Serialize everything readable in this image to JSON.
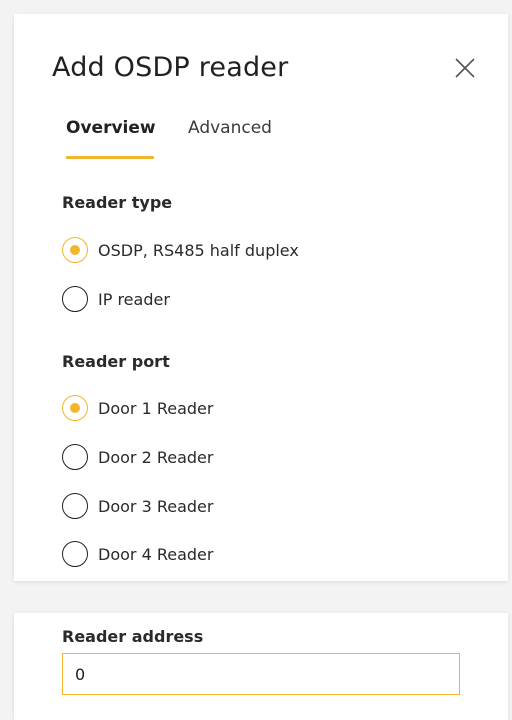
{
  "dialog": {
    "title": "Add OSDP reader",
    "close_icon": "close-icon"
  },
  "tabs": [
    {
      "label": "Overview",
      "active": true
    },
    {
      "label": "Advanced",
      "active": false
    }
  ],
  "reader_type": {
    "label": "Reader type",
    "options": [
      {
        "label": "OSDP, RS485 half duplex",
        "selected": true
      },
      {
        "label": "IP reader",
        "selected": false
      }
    ]
  },
  "reader_port": {
    "label": "Reader port",
    "options": [
      {
        "label": "Door 1 Reader",
        "selected": true
      },
      {
        "label": "Door 2 Reader",
        "selected": false
      },
      {
        "label": "Door 3 Reader",
        "selected": false
      },
      {
        "label": "Door 4 Reader",
        "selected": false
      }
    ]
  },
  "reader_address": {
    "label": "Reader address",
    "value": "0"
  },
  "colors": {
    "accent": "#f2b62e",
    "text": "#212121",
    "background": "#f3f3f3",
    "card": "#ffffff"
  }
}
